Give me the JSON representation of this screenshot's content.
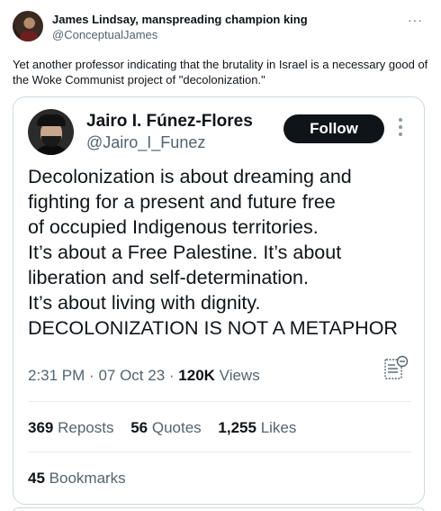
{
  "outer_tweet": {
    "display_name": "James Lindsay, manspreading champion king",
    "handle": "@ConceptualJames",
    "more_icon": "more-horizontal-icon",
    "text": "Yet another professor indicating that the brutality in Israel is a necessary good of the Woke Communist project of \"decolonization.\""
  },
  "quoted_tweet": {
    "display_name": "Jairo I. Fúnez-Flores",
    "handle": "@Jairo_I_Funez",
    "follow_label": "Follow",
    "body_lines": [
      "Decolonization is about dreaming and",
      "fighting for a present and future free",
      "of occupied Indigenous territories.",
      "It’s about a Free Palestine. It’s about",
      "liberation and self-determination.",
      "It’s about living with dignity.",
      "DECOLONIZATION IS NOT A METAPHOR"
    ],
    "time": "2:31 PM",
    "date": "07 Oct 23",
    "views_count": "120K",
    "views_label": "Views",
    "reposts_count": "369",
    "reposts_label": "Reposts",
    "quotes_count": "56",
    "quotes_label": "Quotes",
    "likes_count": "1,255",
    "likes_label": "Likes",
    "bookmarks_count": "45",
    "bookmarks_label": "Bookmarks"
  },
  "colors": {
    "text_primary": "#0f1419",
    "text_secondary": "#536471",
    "border": "#cfd9de",
    "follow_button_bg": "#0f1419"
  }
}
